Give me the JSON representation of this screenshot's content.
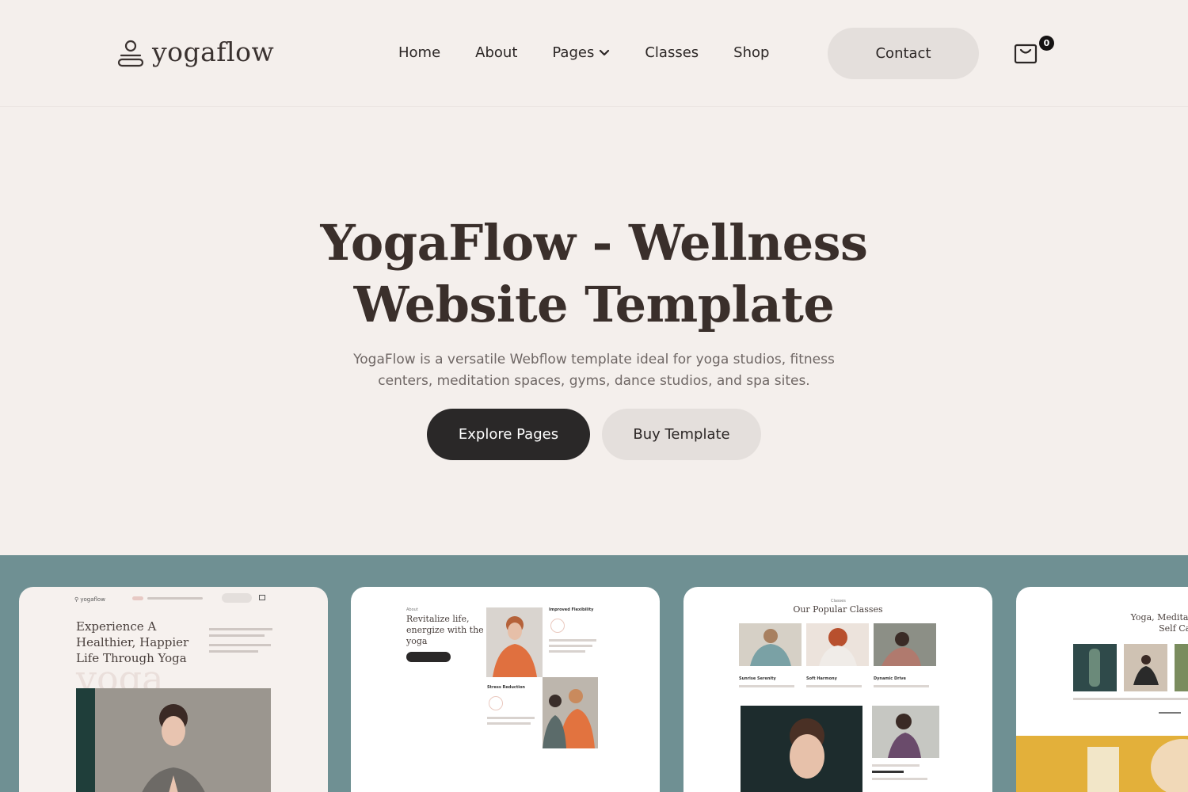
{
  "header": {
    "logo_text": "yogaflow",
    "nav": [
      {
        "label": "Home"
      },
      {
        "label": "About"
      },
      {
        "label": "Pages"
      },
      {
        "label": "Classes"
      },
      {
        "label": "Shop"
      }
    ],
    "contact_label": "Contact",
    "cart_count": "0"
  },
  "hero": {
    "title_line1": "YogaFlow - Wellness",
    "title_line2": "Website Template",
    "subtitle_line1": "YogaFlow is a versatile Webflow template ideal for yoga studios, fitness",
    "subtitle_line2": "centers, meditation spaces, gyms, dance studios, and spa sites.",
    "primary_button": "Explore Pages",
    "secondary_button": "Buy Template"
  },
  "previews": {
    "card1": {
      "heading_line1": "Experience A",
      "heading_line2": "Healthier, Happier",
      "heading_line3": "Life Through Yoga",
      "watermark": "yoga"
    },
    "card2": {
      "heading_line1": "Revitalize life,",
      "heading_line2": "energize with the",
      "heading_line3": "yoga",
      "feature1": "Improved Flexibility",
      "feature2": "Stress Reduction"
    },
    "card3": {
      "heading": "Our Popular Classes",
      "class1": "Sunrise Serenity",
      "class2": "Soft Harmony",
      "class3": "Dynamic Drive"
    },
    "card4": {
      "heading_line1": "Yoga, Meditatio",
      "heading_line2": "Self Care"
    }
  },
  "colors": {
    "background": "#f4efec",
    "strip": "#6f9093",
    "dark_button": "#2a2828",
    "light_button": "#e4dfdc"
  }
}
